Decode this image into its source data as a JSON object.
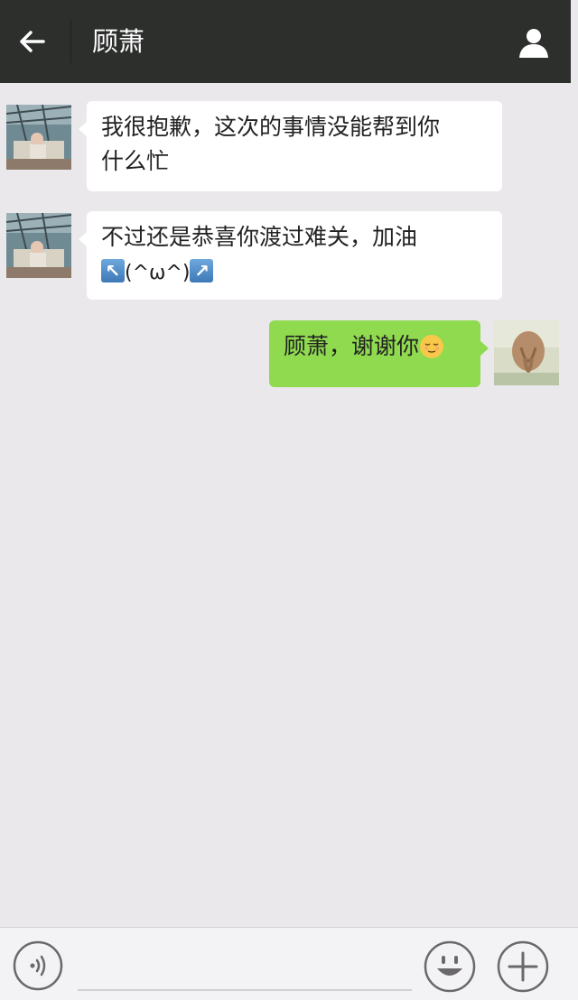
{
  "header": {
    "title": "顾萧",
    "back_icon": "arrow-left-icon",
    "profile_icon": "person-icon"
  },
  "messages": [
    {
      "direction": "incoming",
      "lines": [
        "我很抱歉，这次的事情没能帮到你",
        "什么忙"
      ]
    },
    {
      "direction": "incoming",
      "line1": "不过还是恭喜你渡过难关，加油",
      "line2_face": "(^ω^)",
      "line2_icons": [
        "arrow-up-left-emoji-icon",
        "arrow-up-right-emoji-icon"
      ]
    },
    {
      "direction": "outgoing",
      "text": "顾萧，谢谢你",
      "emoji": "relieved-face-icon"
    }
  ],
  "bottom_bar": {
    "voice_icon": "voice-icon",
    "emoji_icon": "smiley-icon",
    "plus_icon": "plus-icon"
  },
  "colors": {
    "header_bg": "#2d2f2d",
    "chat_bg": "#ebe8ec",
    "incoming_bubble": "#ffffff",
    "outgoing_bubble": "#8fda4f"
  }
}
